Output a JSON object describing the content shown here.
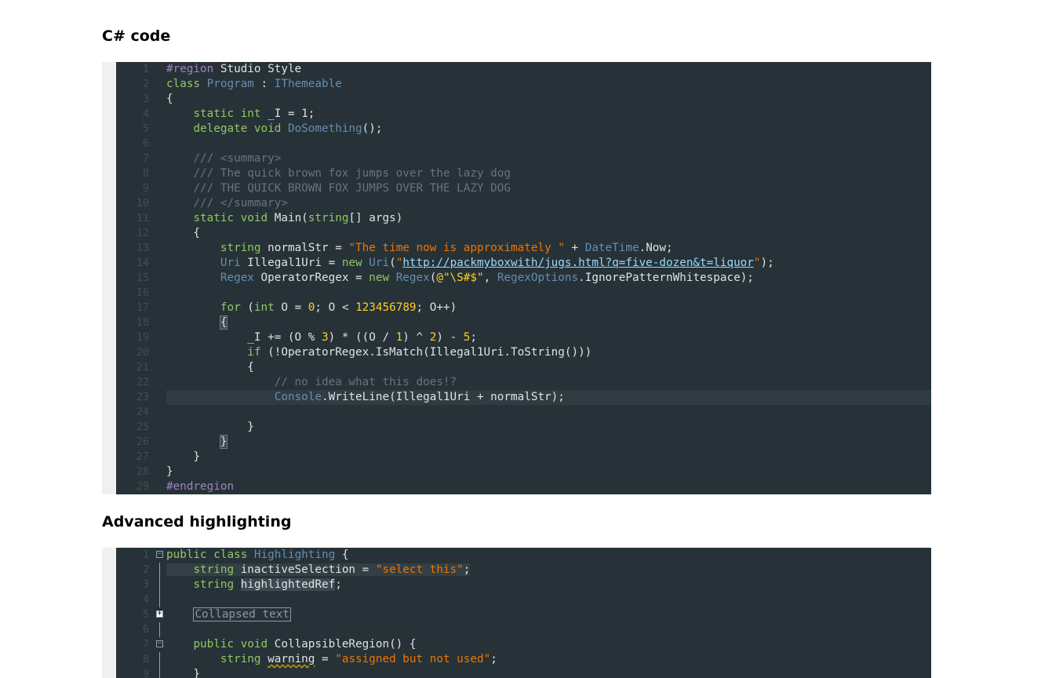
{
  "sections": [
    {
      "title": "C# code"
    },
    {
      "title": "Advanced highlighting"
    }
  ],
  "editor1": {
    "lines": [
      {
        "n": "1",
        "html": "<span class=\"r\">#region</span> Studio Style"
      },
      {
        "n": "2",
        "html": "<span class=\"k\">class</span> <span class=\"t\">Program</span> : <span class=\"t\">IThemeable</span>"
      },
      {
        "n": "3",
        "html": "{"
      },
      {
        "n": "4",
        "html": "    <span class=\"k\">static</span> <span class=\"k\">int</span> _I = 1;"
      },
      {
        "n": "5",
        "html": "    <span class=\"k\">delegate</span> <span class=\"k\">void</span> <span class=\"t\">DoSomething</span>();"
      },
      {
        "n": "6",
        "html": ""
      },
      {
        "n": "7",
        "html": "    <span class=\"c\">/// &lt;summary&gt;</span>"
      },
      {
        "n": "8",
        "html": "    <span class=\"c\">/// The quick brown fox jumps over the lazy dog</span>"
      },
      {
        "n": "9",
        "html": "    <span class=\"c\">/// THE QUICK BROWN FOX JUMPS OVER THE LAZY DOG</span>"
      },
      {
        "n": "10",
        "html": "    <span class=\"c\">/// &lt;/summary&gt;</span>"
      },
      {
        "n": "11",
        "html": "    <span class=\"k\">static</span> <span class=\"k\">void</span> Main(<span class=\"k\">string</span>[] args)"
      },
      {
        "n": "12",
        "html": "    {"
      },
      {
        "n": "13",
        "html": "        <span class=\"k\">string</span> normalStr = <span class=\"s\">\"The time now is approximately \"</span> + <span class=\"t\">DateTime</span>.Now;"
      },
      {
        "n": "14",
        "html": "        <span class=\"t\">Uri</span> Illegal1Uri = <span class=\"k\">new</span> <span class=\"t\">Uri</span>(<span class=\"s\">\"</span><span class=\"u\">http://packmyboxwith/jugs.html?q=five-dozen&amp;t=liquor</span><span class=\"s\">\"</span>);"
      },
      {
        "n": "15",
        "html": "        <span class=\"t\">Regex</span> OperatorRegex = <span class=\"k\">new</span> <span class=\"t\">Regex</span>(<span class=\"n\">@\"\\S#$\"</span>, <span class=\"t\">RegexOptions</span>.IgnorePatternWhitespace);"
      },
      {
        "n": "16",
        "html": ""
      },
      {
        "n": "17",
        "html": "        <span class=\"k\">for</span> (<span class=\"k\">int</span> O = <span class=\"n\">0</span>; O &lt; <span class=\"n\">123456789</span>; O++)"
      },
      {
        "n": "18",
        "html": "        <span class=\"brk\">{</span>"
      },
      {
        "n": "19",
        "html": "            _I += (O % <span class=\"n\">3</span>) * ((O / <span class=\"n\">1</span>) ^ <span class=\"n\">2</span>) - <span class=\"n\">5</span>;"
      },
      {
        "n": "20",
        "html": "            <span class=\"k\">if</span> (!OperatorRegex.IsMatch(Illegal1Uri.ToString()))"
      },
      {
        "n": "21",
        "html": "            {"
      },
      {
        "n": "22",
        "html": "                <span class=\"c\">// no idea what this does!?</span>"
      },
      {
        "n": "23",
        "html": "                <span class=\"t\">Console</span>.WriteLine(Illegal1Uri + normalStr);",
        "hl": true
      },
      {
        "n": "24",
        "html": ""
      },
      {
        "n": "25",
        "html": "            }"
      },
      {
        "n": "26",
        "html": "        <span class=\"brk\">}</span>"
      },
      {
        "n": "27",
        "html": "    }"
      },
      {
        "n": "28",
        "html": "}"
      },
      {
        "n": "29",
        "html": "<span class=\"r\">#endregion</span>"
      }
    ]
  },
  "editor2": {
    "lines": [
      {
        "n": "1",
        "fold": "minus",
        "html": "<span class=\"k\">public</span> <span class=\"k\">class</span> <span class=\"t\">Highlighting</span> {"
      },
      {
        "n": "2",
        "fold": "line",
        "html": "<span class=\"sel\">    <span class=\"k\">string</span> inactiveSelection = <span class=\"s\">\"select this\"</span>;</span>"
      },
      {
        "n": "3",
        "fold": "line",
        "html": "    <span class=\"k\">string</span> <span class=\"ref\">highlightedRef</span>;"
      },
      {
        "n": "4",
        "fold": "line",
        "html": ""
      },
      {
        "n": "5",
        "fold": "plus",
        "html": "    <span class=\"collapsed\">Collapsed text</span>"
      },
      {
        "n": "6",
        "fold": "line",
        "html": ""
      },
      {
        "n": "7",
        "fold": "minus",
        "html": "    <span class=\"k\">public</span> <span class=\"k\">void</span> CollapsibleRegion() {"
      },
      {
        "n": "8",
        "fold": "line",
        "html": "        <span class=\"k\">string</span> <span class=\"warn\">warning</span> = <span class=\"s\">\"assigned but not used\"</span>;"
      },
      {
        "n": "9",
        "fold": "line",
        "html": "    }"
      }
    ]
  }
}
